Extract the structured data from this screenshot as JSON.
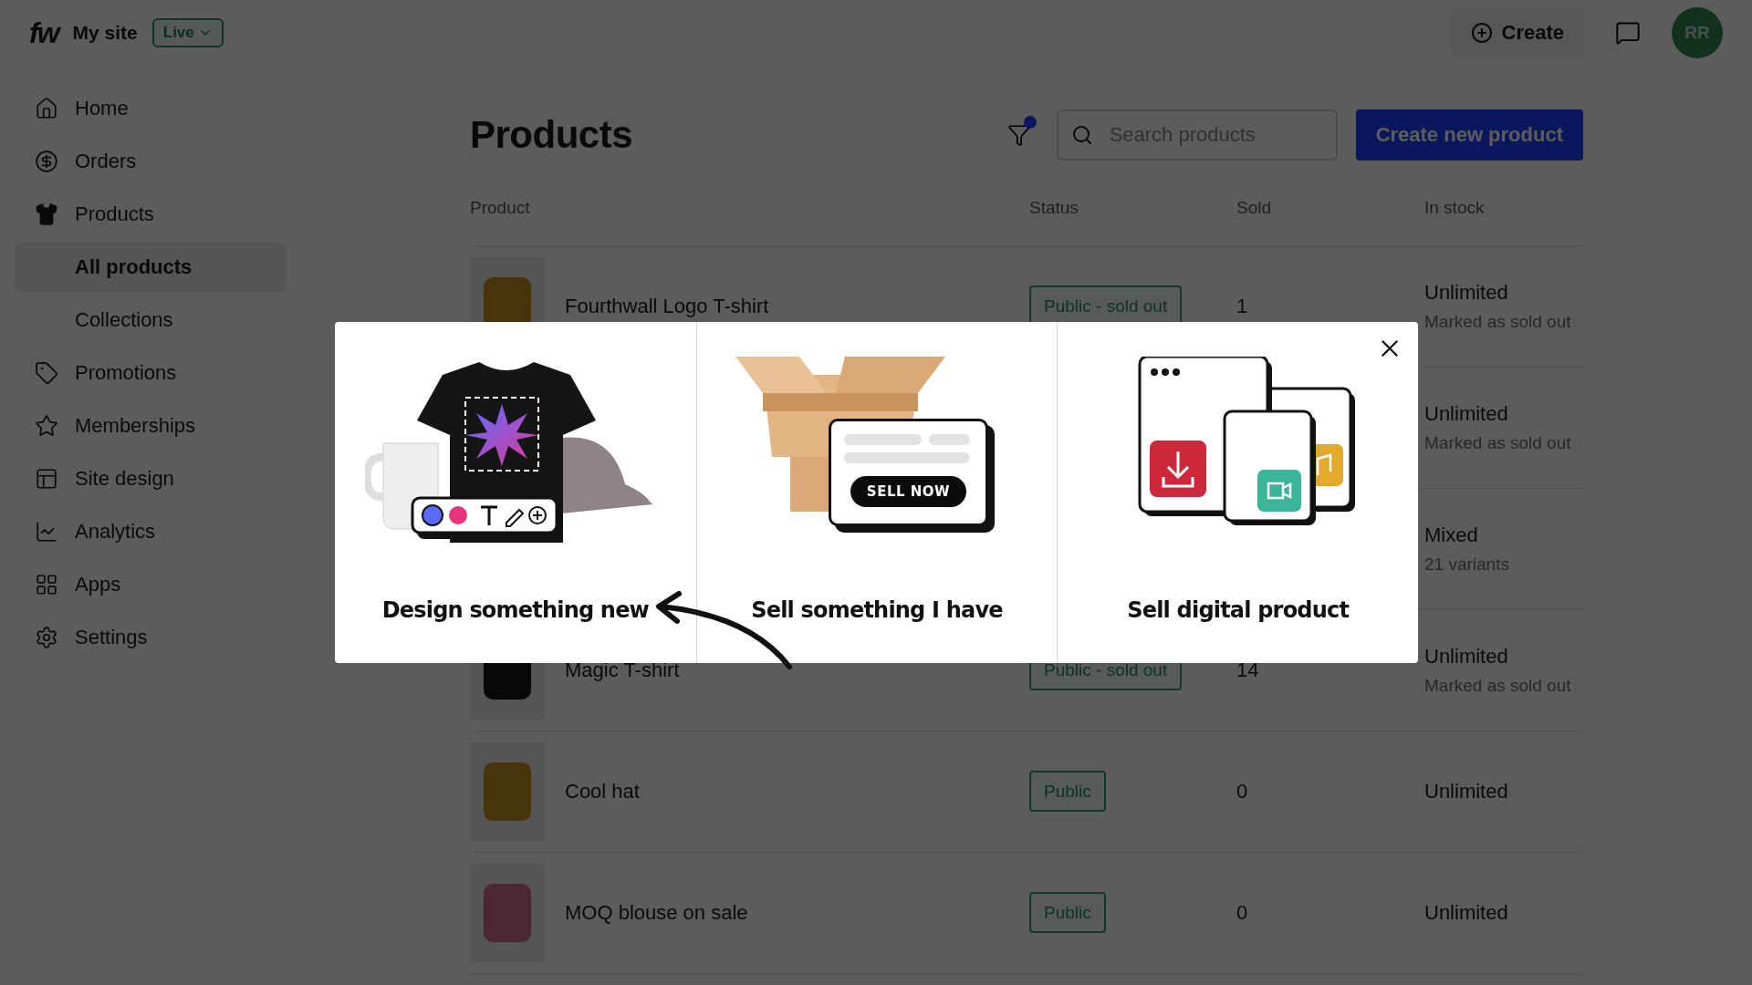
{
  "header": {
    "logo": "fw",
    "site_name": "My site",
    "site_status": "Live",
    "create_button": "Create",
    "avatar": "RR"
  },
  "sidebar": {
    "items": [
      {
        "label": "Home",
        "selected": false
      },
      {
        "label": "Orders",
        "selected": false
      },
      {
        "label": "Products",
        "selected": false,
        "expanded": true,
        "children": [
          {
            "label": "All products",
            "selected": true
          },
          {
            "label": "Collections",
            "selected": false
          }
        ]
      },
      {
        "label": "Promotions",
        "selected": false
      },
      {
        "label": "Memberships",
        "selected": false
      },
      {
        "label": "Site design",
        "selected": false
      },
      {
        "label": "Analytics",
        "selected": false
      },
      {
        "label": "Apps",
        "selected": false
      },
      {
        "label": "Settings",
        "selected": false
      }
    ]
  },
  "page": {
    "title": "Products",
    "filter_active": true,
    "search": {
      "placeholder": "Search products"
    },
    "primary_button": "Create new product"
  },
  "table": {
    "columns": [
      "Product",
      "Status",
      "Sold",
      "In stock"
    ],
    "rows": [
      {
        "product": "Fourthwall Logo T-shirt",
        "status": "Public - sold out",
        "sold": "1",
        "stock": "Unlimited",
        "stock_note": "Marked as sold out"
      },
      {
        "stock": "Unlimited",
        "stock_note": "Marked as sold out"
      },
      {
        "stock": "Mixed",
        "stock_note": "21 variants"
      },
      {
        "product": "Magic T-shirt",
        "status": "Public - sold out",
        "sold": "14",
        "stock": "Unlimited",
        "stock_note": "Marked as sold out"
      },
      {
        "product": "Cool hat",
        "status": "Public",
        "sold": "0",
        "stock": "Unlimited"
      },
      {
        "product": "MOQ blouse on sale",
        "status": "Public",
        "sold": "0",
        "stock": "Unlimited"
      }
    ]
  },
  "modal": {
    "options": [
      {
        "kind": "design",
        "label": "Design something new"
      },
      {
        "kind": "physical",
        "label": "Sell something I have",
        "badge": "SELL NOW"
      },
      {
        "kind": "digital",
        "label": "Sell digital product"
      }
    ]
  }
}
